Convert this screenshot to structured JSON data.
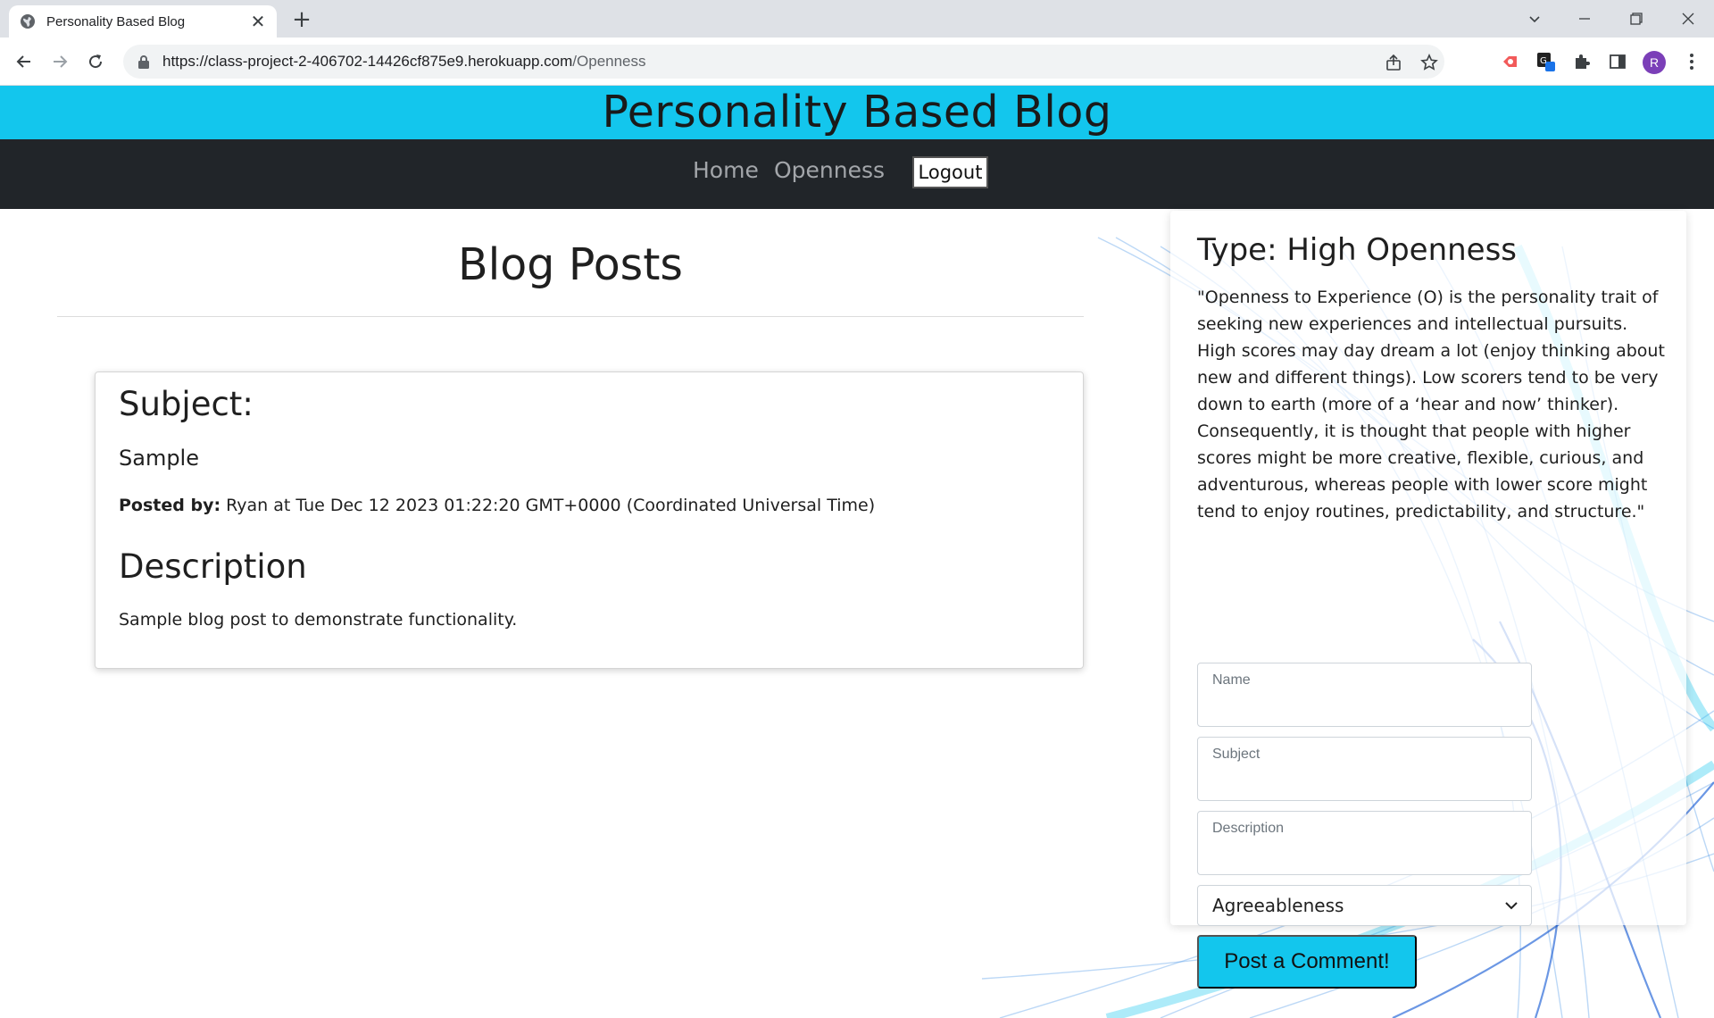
{
  "browser": {
    "tab_title": "Personality Based Blog",
    "tab_close": "✕",
    "new_tab": "+",
    "url_host": "https://class-project-2-406702-14426cf875e9.herokuapp.com",
    "url_path": "/Openness",
    "avatar_letter": "R"
  },
  "site": {
    "title": "Personality Based Blog",
    "nav": {
      "home": "Home",
      "openness": "Openness",
      "logout": "Logout"
    }
  },
  "posts": {
    "heading": "Blog Posts",
    "items": [
      {
        "subject_label": "Subject:",
        "subject": "Sample",
        "posted_by_label": "Posted by:",
        "posted_by": "Ryan at Tue Dec 12 2023 01:22:20 GMT+0000 (Coordinated Universal Time)",
        "description_label": "Description",
        "description": "Sample blog post to demonstrate functionality."
      }
    ]
  },
  "sidebar": {
    "type_heading": "Type: High Openness",
    "type_description": "\"Openness to Experience (O) is the personality trait of seeking new experiences and intellectual pursuits. High scores may day dream a lot (enjoy thinking about new and different things). Low scorers tend to be very down to earth (more of a ‘hear and now’ thinker). Consequently, it is thought that people with higher scores might be more creative, flexible, curious, and adventurous, whereas people with lower score might tend to enjoy routines, predictability, and structure.\"",
    "form": {
      "name_label": "Name",
      "subject_label": "Subject",
      "description_label": "Description",
      "type_select_value": "Agreeableness",
      "submit_label": "Post a Comment!"
    }
  },
  "colors": {
    "header_bg": "#13c6ed",
    "nav_bg": "#212529",
    "button_bg": "#13c6ed"
  }
}
